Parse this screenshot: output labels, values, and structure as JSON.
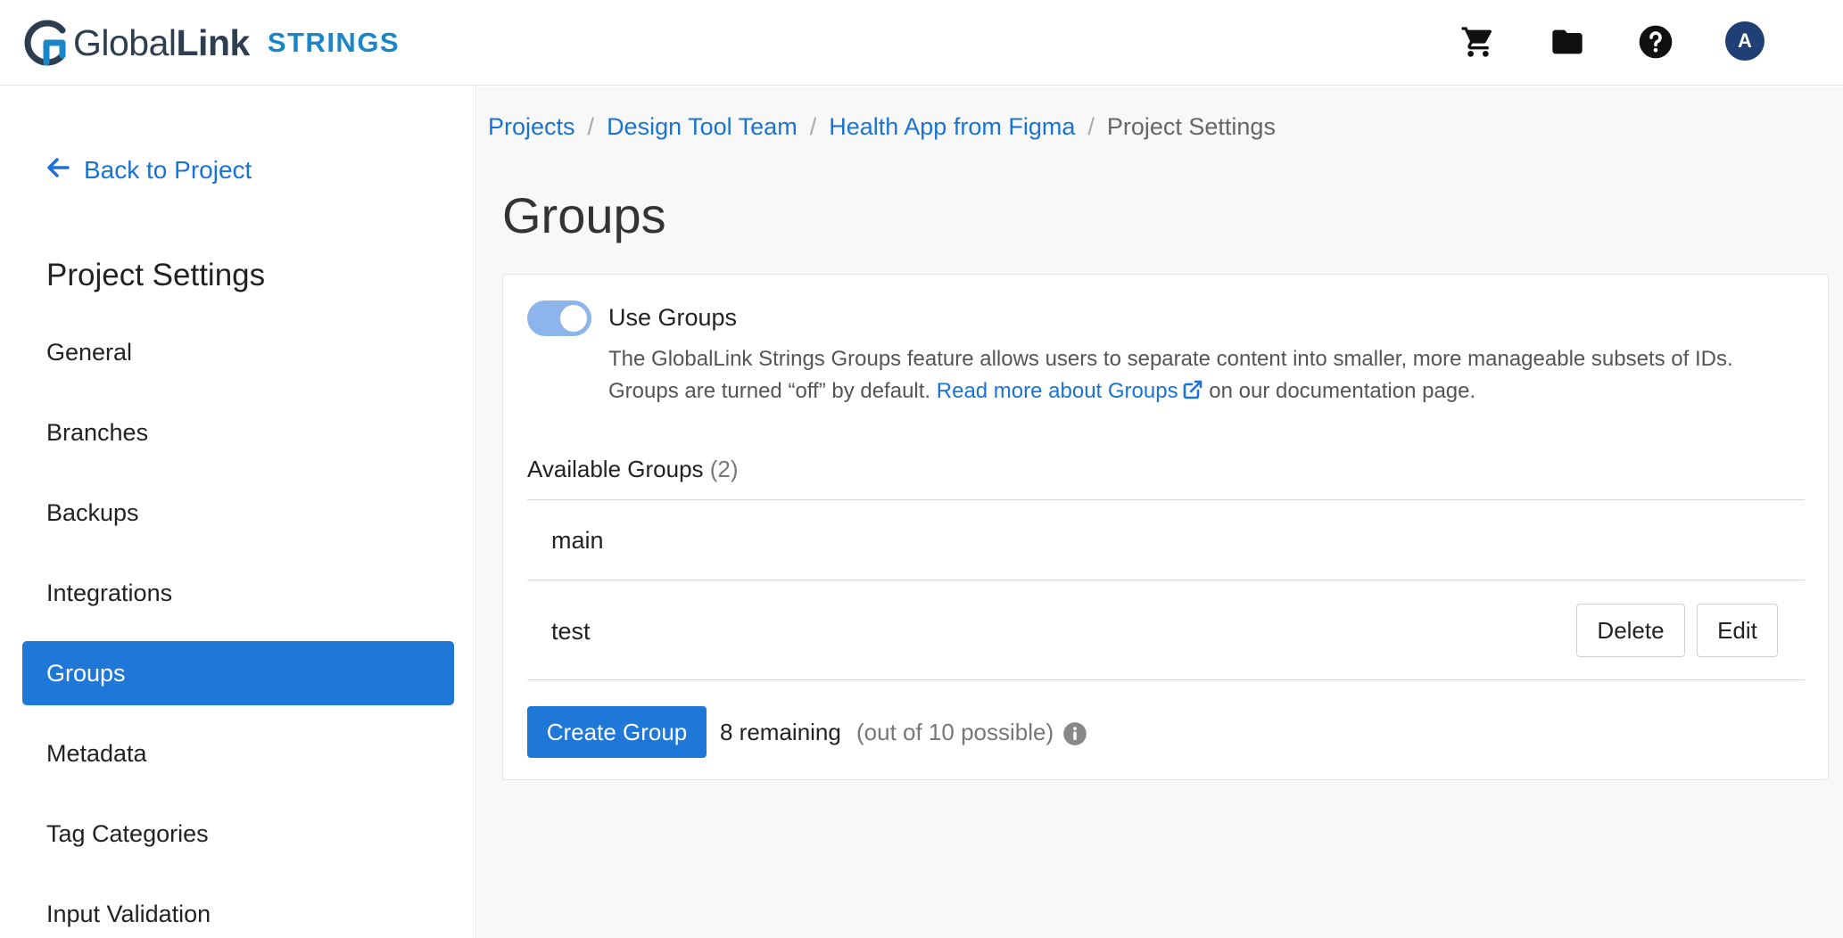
{
  "header": {
    "logo_name_light": "Global",
    "logo_name_bold": "Link",
    "logo_product": "STRINGS",
    "icons": [
      "cart-icon",
      "folder-icon",
      "help-icon"
    ],
    "avatar_initial": "A",
    "colors": {
      "brand_dark": "#2c3e50",
      "brand_blue": "#1a85c7",
      "avatar_bg": "#1f3f75"
    }
  },
  "sidebar": {
    "back_label": "Back to Project",
    "title": "Project Settings",
    "items": [
      {
        "label": "General",
        "active": false
      },
      {
        "label": "Branches",
        "active": false
      },
      {
        "label": "Backups",
        "active": false
      },
      {
        "label": "Integrations",
        "active": false
      },
      {
        "label": "Groups",
        "active": true
      },
      {
        "label": "Metadata",
        "active": false
      },
      {
        "label": "Tag Categories",
        "active": false
      },
      {
        "label": "Input Validation",
        "active": false
      }
    ],
    "active_color": "#1f78d8"
  },
  "breadcrumb": {
    "items": [
      "Projects",
      "Design Tool Team",
      "Health App from Figma"
    ],
    "current": "Project Settings",
    "separator": "/"
  },
  "main": {
    "title": "Groups",
    "toggle": {
      "label": "Use Groups",
      "on": true
    },
    "description_part1": "The GlobalLink Strings Groups feature allows users to separate content into smaller, more manageable subsets of IDs. Groups are turned “off” by default.",
    "description_link": "Read more about Groups",
    "description_part2": "on our documentation page.",
    "available_label": "Available Groups",
    "available_count": "(2)",
    "groups": [
      {
        "name": "main"
      },
      {
        "name": "test",
        "delete_label": "Delete",
        "edit_label": "Edit"
      }
    ],
    "create_label": "Create Group",
    "remaining": "8 remaining",
    "possible": "(out of 10 possible)"
  }
}
